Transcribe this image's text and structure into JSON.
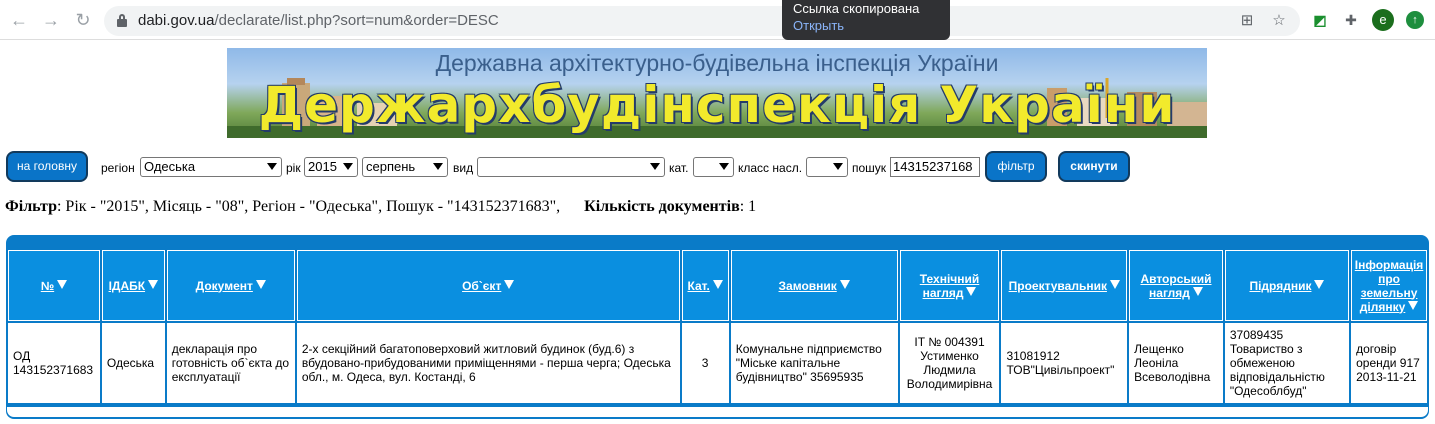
{
  "browser": {
    "url_host": "dabi.gov.ua",
    "url_path": "/declarate/list.php?sort=num&order=DESC",
    "toast_title": "Ссылка скопирована",
    "toast_action": "Открыть",
    "profile_initial": "e"
  },
  "banner": {
    "subtitle": "Державна архітектурно-будівельна інспекція України",
    "title": "Держархбудінспекція України"
  },
  "filters": {
    "home_button": "на головну",
    "region_label": "регіон",
    "region_value": "Одеська",
    "year_label": "рік",
    "year_value": "2015",
    "month_value": "серпень",
    "type_label": "вид",
    "type_value": "",
    "cat_label": "кат.",
    "cat_value": "",
    "class_label": "класс насл.",
    "class_value": "",
    "search_label": "пошук",
    "search_value": "14315237168",
    "filter_button": "фільтр",
    "reset_button": "скинути"
  },
  "summary": {
    "filter_label": "Фільтр",
    "filter_text": ": Рік - \"2015\", Місяць - \"08\", Регіон - \"Одеська\", Пошук - \"143152371683\",",
    "count_label": "Кількість документів",
    "count_value": ": 1"
  },
  "table": {
    "headers": [
      "№",
      "ІДАБК",
      "Документ",
      "Об`єкт",
      "Кат.",
      "Замовник",
      "Технічний нагляд",
      "Проектувальник",
      "Авторський нагляд",
      "Підрядник",
      "Інформація про земельну ділянку"
    ],
    "rows": [
      {
        "num": "ОД 143152371683",
        "idabk": "Одеська",
        "document": "декларація про готовність об`єкта до експлуатації",
        "object": "2-х секційний багатоповерховий житловий будинок (буд.6) з вбудовано-прибудованими приміщеннями - перша черга; Одеська обл., м. Одеса, вул. Костанді, 6",
        "cat": "3",
        "customer": "Комунальне підприємство \"Міське капітальне будівництво\" 35695935",
        "tech_supervision": "ІТ № 004391 Устименко Людмила Володимирівна",
        "designer": "31081912 ТОВ\"Цивільпроект\"",
        "author_supervision": "Лещенко Леоніла Всеволодівна",
        "contractor": "37089435 Товариство з обмеженою відповідальністю \"Одесоблбуд\"",
        "land_info": "договір оренди 917 2013-11-21"
      }
    ]
  }
}
